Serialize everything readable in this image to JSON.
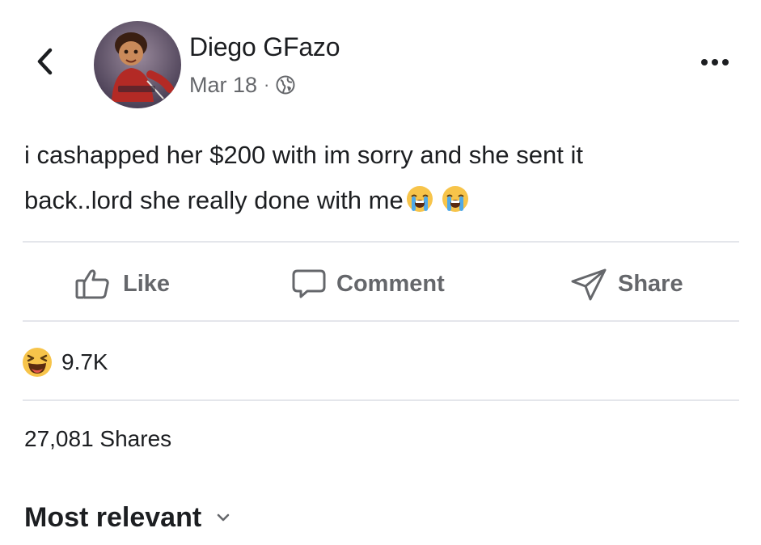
{
  "post": {
    "author_name": "Diego GFazo",
    "date": "Mar 18",
    "separator": "·",
    "privacy_icon": "globe-icon",
    "text_line1": "i cashapped her $200 with im sorry and she sent it",
    "text_line2": "back..lord she really done with me",
    "text_emojis": [
      "loudly-crying-face-emoji",
      "loudly-crying-face-emoji"
    ]
  },
  "actions": {
    "like_label": "Like",
    "comment_label": "Comment",
    "share_label": "Share"
  },
  "reactions": {
    "icon": "laughing-face-emoji",
    "count": "9.7K"
  },
  "shares": {
    "label": "27,081 Shares"
  },
  "comments": {
    "sort_label": "Most relevant"
  },
  "colors": {
    "text_primary": "#1c1e21",
    "text_secondary": "#65676b",
    "divider": "#e4e6eb",
    "emoji_yellow": "#f7c44a",
    "tear_blue": "#4fa9e8"
  }
}
